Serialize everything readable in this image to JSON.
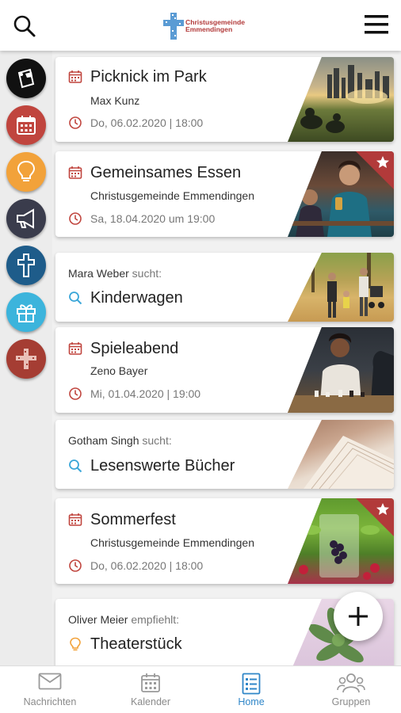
{
  "header": {
    "logo_text": "Christusgemeinde\nEmmendingen",
    "logo_color": "#b23a3a"
  },
  "side_categories": [
    {
      "name": "pinboard",
      "icon": "pin-board-icon",
      "color": "#111111"
    },
    {
      "name": "calendar",
      "icon": "calendar-icon",
      "color": "#c0453e"
    },
    {
      "name": "ideas",
      "icon": "lightbulb-icon",
      "color": "#f2a23a"
    },
    {
      "name": "announcements",
      "icon": "megaphone-icon",
      "color": "#3a3c4c"
    },
    {
      "name": "faith",
      "icon": "cross-icon",
      "color": "#1e5c8a"
    },
    {
      "name": "gifts",
      "icon": "gift-icon",
      "color": "#3cb4dc"
    },
    {
      "name": "church",
      "icon": "church-logo-icon",
      "color": "#a53d33"
    }
  ],
  "feed": [
    {
      "type": "event",
      "title": "Picknick im Park",
      "organizer": "Max Kunz",
      "date": "Do, 06.02.2020 | 18:00",
      "featured": false
    },
    {
      "type": "event",
      "title": "Gemeinsames Essen",
      "organizer": "Christusgemeinde Emmendingen",
      "date": "Sa, 18.04.2020 um 19:00",
      "featured": true
    },
    {
      "type": "search",
      "poster": "Mara Weber",
      "verb": "sucht:",
      "title": "Kinderwagen"
    },
    {
      "type": "event",
      "title": "Spieleabend",
      "organizer": "Zeno Bayer",
      "date": "Mi, 01.04.2020 | 19:00",
      "featured": false
    },
    {
      "type": "search",
      "poster": "Gotham Singh",
      "verb": "sucht:",
      "title": "Lesenswerte Bücher"
    },
    {
      "type": "event",
      "title": "Sommerfest",
      "organizer": "Christusgemeinde Emmendingen",
      "date": "Do, 06.02.2020 | 18:00",
      "featured": true
    },
    {
      "type": "recommend",
      "poster": "Oliver Meier",
      "verb": "empfiehlt:",
      "title": "Theaterstück"
    }
  ],
  "bottom_nav": [
    {
      "label": "Nachrichten",
      "icon": "envelope-icon",
      "active": false
    },
    {
      "label": "Kalender",
      "icon": "calendar-icon",
      "active": false
    },
    {
      "label": "Home",
      "icon": "list-icon",
      "active": true
    },
    {
      "label": "Gruppen",
      "icon": "group-icon",
      "active": false
    }
  ],
  "colors": {
    "accent": "#2f86c8",
    "event_icon": "#c0453e",
    "search_icon": "#3aa6d8",
    "idea_icon": "#f2a23a",
    "star_corner": "#b23a3a"
  }
}
